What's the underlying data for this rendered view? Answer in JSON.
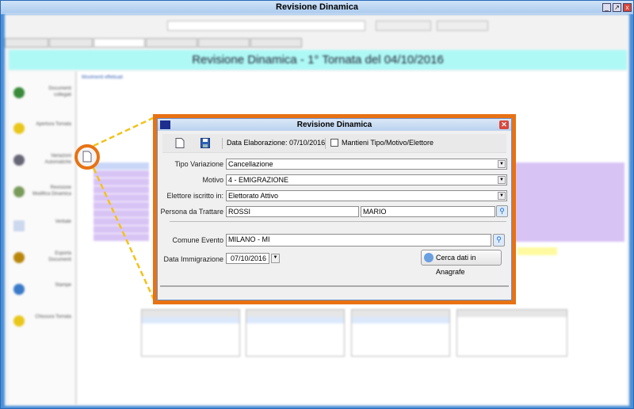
{
  "window": {
    "title": "Revisione Dinamica"
  },
  "background": {
    "banner": "Revisione Dinamica - 1° Tornata del 04/10/2016",
    "sidebar": [
      "Documenti collegati",
      "Apertura Tornata",
      "Variazioni Automatiche",
      "Revisione Modifica Dinamica",
      "Verbale",
      "Esporta Documenti",
      "Stampe",
      "Chiusura Tornata"
    ],
    "section_link": "Movimenti effettuati"
  },
  "dialog": {
    "title": "Revisione Dinamica",
    "toolbar": {
      "data_elaborazione": "Data Elaborazione: 07/10/2016",
      "mantieni_label": "Mantieni Tipo/Motivo/Elettore",
      "mantieni_checked": false
    },
    "fields": {
      "tipo_variazione": {
        "label": "Tipo Variazione",
        "value": "Cancellazione"
      },
      "motivo": {
        "label": "Motivo",
        "value": "4 - EMIGRAZIONE"
      },
      "elettore": {
        "label": "Elettore iscritto in:",
        "value": "Elettorato Attivo"
      },
      "persona": {
        "label": "Persona da Trattare",
        "cognome": "ROSSI",
        "nome": "MARIO"
      },
      "comune": {
        "label": "Comune Evento",
        "value": "MILANO - MI"
      },
      "data_immigrazione": {
        "label": "Data Immigrazione",
        "value": "07/10/2016"
      }
    },
    "cerca_button": "Cerca dati in Anagrafe"
  },
  "colors": {
    "highlight": "#e87213",
    "callout_line": "#f3c21a",
    "banner": "#aef9f6"
  }
}
